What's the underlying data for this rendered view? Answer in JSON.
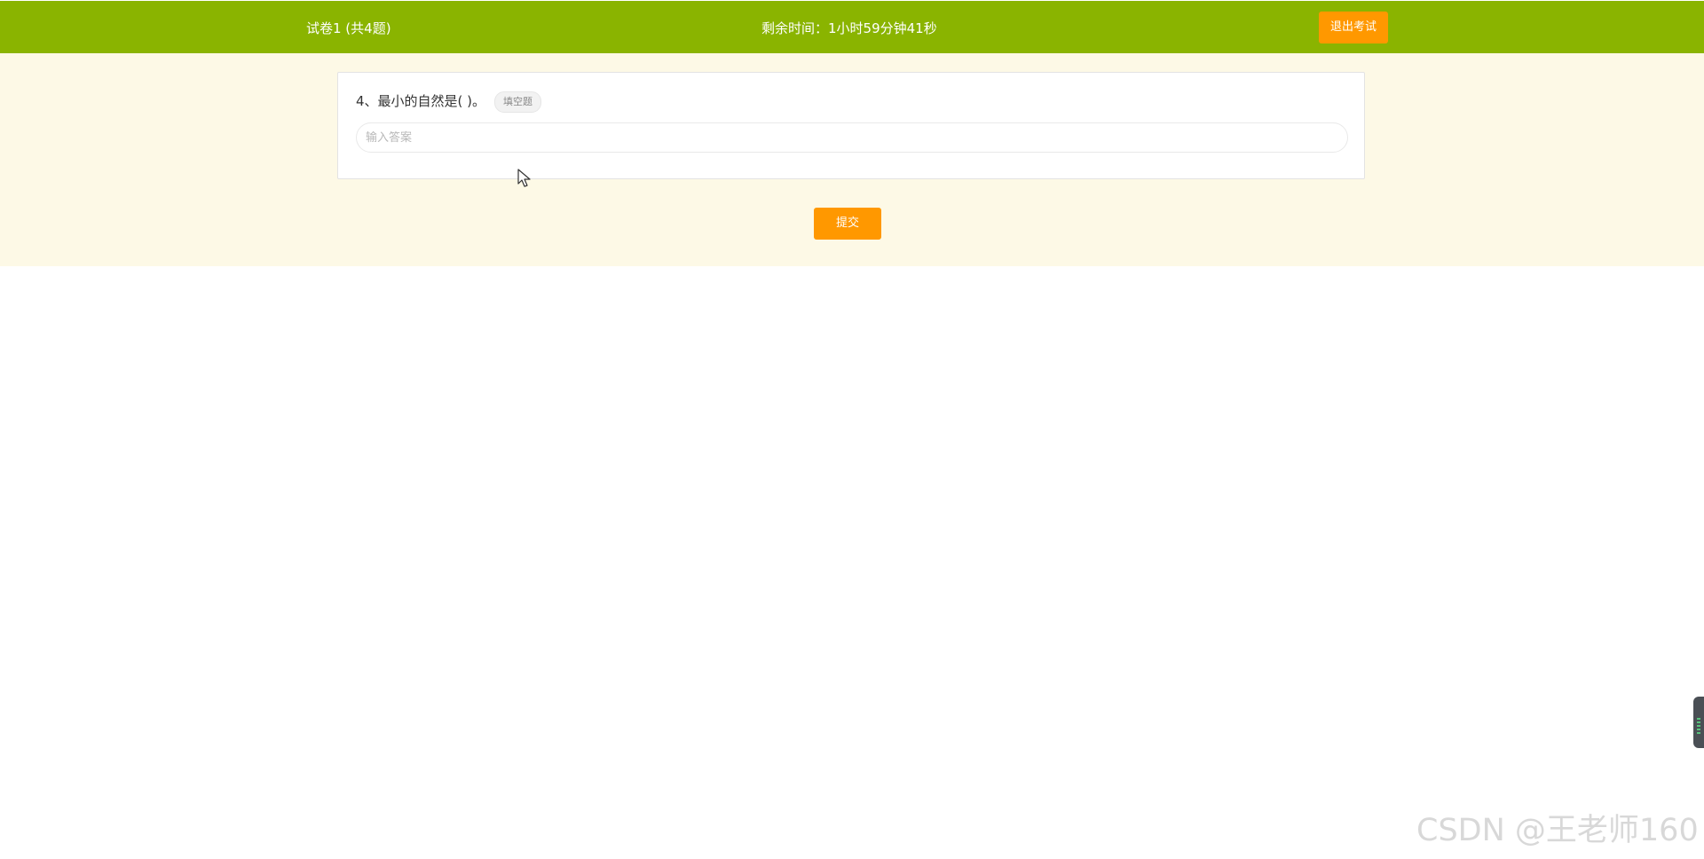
{
  "header": {
    "exam_title": "试卷1 (共4题)",
    "timer": "剩余时间：1小时59分钟41秒",
    "exit_label": "退出考试"
  },
  "question": {
    "text": "4、最小的自然是( )。",
    "type_tag": "填空题",
    "answer_value": "",
    "answer_placeholder": "输入答案"
  },
  "actions": {
    "submit_label": "提交"
  },
  "watermark": {
    "text": "CSDN @王老师160"
  },
  "colors": {
    "header_background": "#8ab400",
    "content_background": "#fdf9e6",
    "button_background": "#ff9800"
  },
  "icons": {
    "cursor": "mouse-pointer-icon",
    "side_widget": "side-panel-handle"
  }
}
